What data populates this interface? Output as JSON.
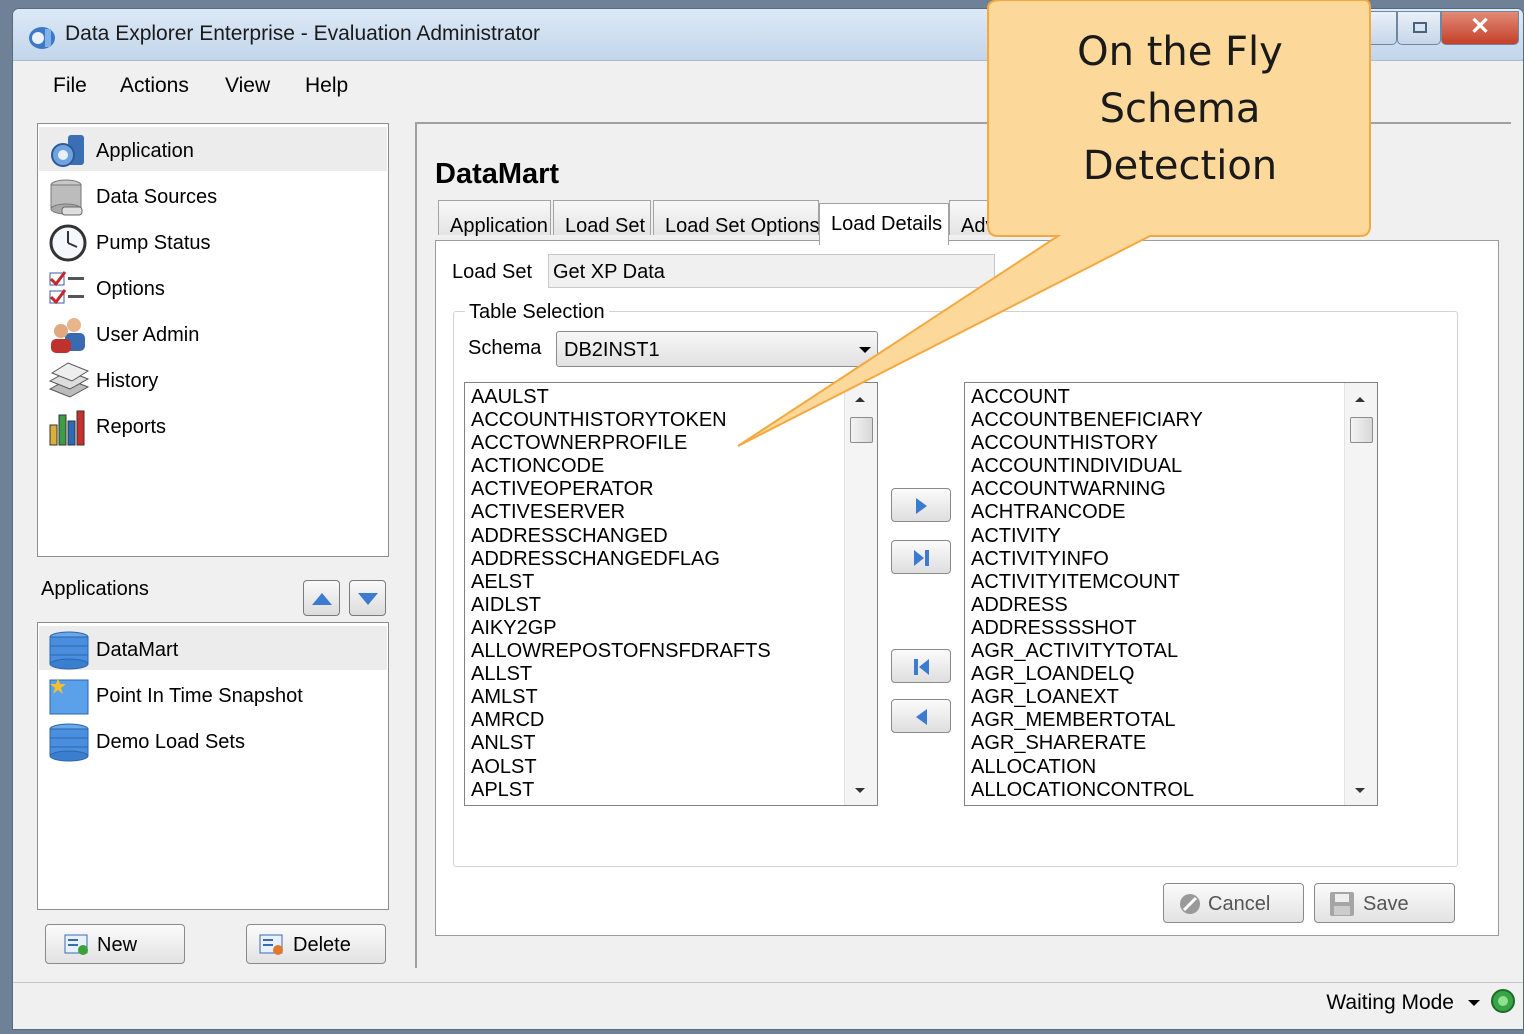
{
  "window": {
    "title": "Data Explorer Enterprise  - Evaluation Administrator"
  },
  "menu": [
    "File",
    "Actions",
    "View",
    "Help"
  ],
  "nav": [
    {
      "label": "Application",
      "icon": "application-icon"
    },
    {
      "label": "Data Sources",
      "icon": "database-icon"
    },
    {
      "label": "Pump Status",
      "icon": "clock-icon"
    },
    {
      "label": "Options",
      "icon": "checklist-icon"
    },
    {
      "label": "User Admin",
      "icon": "users-icon"
    },
    {
      "label": "History",
      "icon": "history-icon"
    },
    {
      "label": "Reports",
      "icon": "bar-chart-icon"
    }
  ],
  "applications": {
    "label": "Applications",
    "items": [
      {
        "label": "DataMart",
        "icon": "database-icon"
      },
      {
        "label": "Point In Time Snapshot",
        "icon": "snapshot-icon"
      },
      {
        "label": "Demo Load Sets",
        "icon": "database-icon"
      }
    ],
    "new_label": "New",
    "delete_label": "Delete"
  },
  "main": {
    "title": "DataMart",
    "tabs": [
      "Application",
      "Load Set",
      "Load Set Options",
      "Load Details",
      "Adva"
    ],
    "active_tab": "Load Details",
    "load_set_label": "Load Set",
    "load_set_value": "Get XP Data",
    "table_selection_label": "Table Selection",
    "schema_label": "Schema",
    "schema_value": "DB2INST1",
    "left_list": [
      "AAULST",
      "ACCOUNTHISTORYTOKEN",
      "ACCTOWNERPROFILE",
      "ACTIONCODE",
      "ACTIVEOPERATOR",
      "ACTIVESERVER",
      "ADDRESSCHANGED",
      "ADDRESSCHANGEDFLAG",
      "AELST",
      "AIDLST",
      "AIKY2GP",
      "ALLOWREPOSTOFNSFDRAFTS",
      "ALLST",
      "AMLST",
      "AMRCD",
      "ANLST",
      "AOLST",
      "APLST"
    ],
    "right_list": [
      "ACCOUNT",
      "ACCOUNTBENEFICIARY",
      "ACCOUNTHISTORY",
      "ACCOUNTINDIVIDUAL",
      "ACCOUNTWARNING",
      "ACHTRANCODE",
      "ACTIVITY",
      "ACTIVITYINFO",
      "ACTIVITYITEMCOUNT",
      "ADDRESS",
      "ADDRESSSSHOT",
      "AGR_ACTIVITYTOTAL",
      "AGR_LOANDELQ",
      "AGR_LOANEXT",
      "AGR_MEMBERTOTAL",
      "AGR_SHARERATE",
      "ALLOCATION",
      "ALLOCATIONCONTROL"
    ],
    "cancel_label": "Cancel",
    "save_label": "Save"
  },
  "status": {
    "text": "Waiting Mode"
  },
  "callout": {
    "line1": "On the Fly",
    "line2": "Schema",
    "line3": "Detection",
    "color": "#fcd89a"
  }
}
